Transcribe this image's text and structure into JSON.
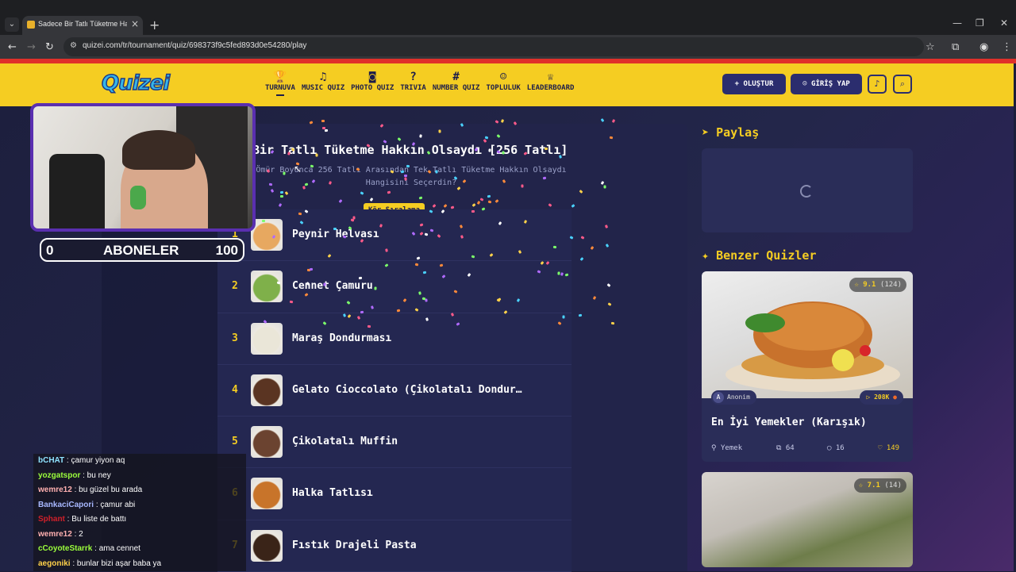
{
  "browser": {
    "tab_title": "Sadece Bir Tatlı Tüketme Hakkın",
    "url": "quizei.com/tr/tournament/quiz/698373f9c5fed893d0e54280/play"
  },
  "header": {
    "logo": "Quizei",
    "nav": [
      {
        "icon": "trophy-icon",
        "glyph": "🏆",
        "label": "TURNUVA"
      },
      {
        "icon": "music-icon",
        "glyph": "♫",
        "label": "MUSIC QUIZ"
      },
      {
        "icon": "camera-icon",
        "glyph": "◙",
        "label": "PHOTO QUIZ"
      },
      {
        "icon": "question-icon",
        "glyph": "?",
        "label": "TRIVIA"
      },
      {
        "icon": "hash-icon",
        "glyph": "#",
        "label": "NUMBER QUIZ"
      },
      {
        "icon": "users-icon",
        "glyph": "☺",
        "label": "TOPLULUK"
      },
      {
        "icon": "medal-icon",
        "glyph": "♕",
        "label": "LEADERBOARD"
      }
    ],
    "create_label": "+ OLUŞTUR",
    "login_label": "GİRİŞ YAP"
  },
  "quiz": {
    "title": "Bir Tatlı Tüketme Hakkın Olsaydı [256 Tatlı]",
    "description": "Ömür Boyunca 256 Tatlı Arasından Tek Tatlı Tüketme Hakkın Olsaydı Hangisini Seçerdin?",
    "badge": "Kör Sıralama",
    "items": [
      {
        "num": "1",
        "name": "Peynir Helvası",
        "color": "#e7a860"
      },
      {
        "num": "2",
        "name": "Cennet Çamuru",
        "color": "#7fb04a"
      },
      {
        "num": "3",
        "name": "Maraş Dondurması",
        "color": "#eae6d8"
      },
      {
        "num": "4",
        "name": "Gelato Cioccolato (Çikolatalı Dondur…",
        "color": "#5a3422"
      },
      {
        "num": "5",
        "name": "Çikolatalı Muffin",
        "color": "#6b4330"
      },
      {
        "num": "6",
        "name": "Halka Tatlısı",
        "color": "#c8742a"
      },
      {
        "num": "7",
        "name": "Fıstık Drajeli Pasta",
        "color": "#3a2418"
      }
    ]
  },
  "sidebar": {
    "share_title": "Paylaş",
    "similar_title": "Benzer Quizler",
    "card": {
      "rating": "9.1",
      "rating_count": "(124)",
      "author": "Anonim",
      "author_initial": "A",
      "plays": "208K",
      "title": "En İyi Yemekler (Karışık)",
      "category": "Yemek",
      "questions": "64",
      "comments": "16",
      "likes": "149"
    },
    "card2": {
      "rating": "7.1",
      "rating_count": "(14)"
    }
  },
  "stream": {
    "subs_left": "0",
    "subs_label": "ABONELER",
    "subs_right": "100",
    "chat": [
      {
        "user": "bCHAT",
        "color": "#8fe3ff",
        "msg": ": çamur yiyon aq"
      },
      {
        "user": "yozgatspor",
        "color": "#9cff3c",
        "msg": ": bu ney"
      },
      {
        "user": "wemre12",
        "color": "#ffb0b0",
        "msg": ": bu güzel bu arada"
      },
      {
        "user": "BankaciCapori",
        "color": "#a8b8ff",
        "msg": ": çamur abi"
      },
      {
        "user": "Sphant",
        "color": "#d0202a",
        "msg": ": Bu liste de battı"
      },
      {
        "user": "wemre12",
        "color": "#ffb0b0",
        "msg": ": 2"
      },
      {
        "user": "cCoyoteStarrk",
        "color": "#9cff3c",
        "msg": ": ama cennet"
      },
      {
        "user": "aegoniki",
        "color": "#ffd24a",
        "msg": ": bunlar bizi aşar baba ya"
      }
    ]
  }
}
